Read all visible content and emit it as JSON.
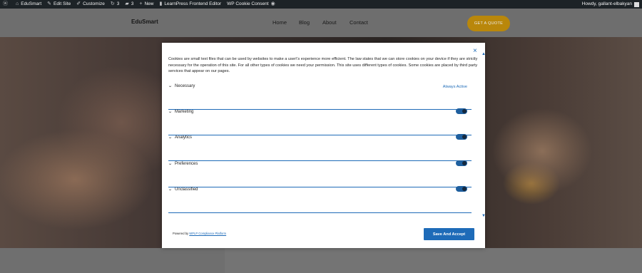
{
  "adminbar": {
    "site_name": "EduSmart",
    "edit_site": "Edit Site",
    "customize": "Customize",
    "updates_count": "3",
    "comments_count": "3",
    "new_label": "New",
    "learnpress": "LearnPress Frontend Editor",
    "cookie_consent": "WP Cookie Consent",
    "howdy": "Howdy, gallant-elbakyan"
  },
  "header": {
    "logo": "EduSmart",
    "nav": [
      "Home",
      "Blog",
      "About",
      "Contact"
    ],
    "quote_button": "GET A QUOTE"
  },
  "modal": {
    "close_icon": "×",
    "intro": "Cookies are small text files that can be used by websites to make a user\\'s experience more efficient. The law states that we can store cookies on your device if they are strictly necessary for the operation of this site. For all other types of cookies we need your permission. This site uses different types of cookies. Some cookies are placed by third party services that appear on our pages.",
    "categories": [
      {
        "label": "Necessary",
        "status": "Always Active"
      },
      {
        "label": "Marketing",
        "enabled": true
      },
      {
        "label": "Analytics",
        "enabled": true
      },
      {
        "label": "Preferences",
        "enabled": true
      },
      {
        "label": "Unclassified",
        "enabled": true
      }
    ],
    "powered_prefix": "Powered by",
    "powered_link": "WPLP Compliance Platform",
    "save_button": "Save And Accept"
  },
  "colors": {
    "accent": "#1e6bb8",
    "quote_button": "#b9870b",
    "adminbar": "#1d2327"
  }
}
